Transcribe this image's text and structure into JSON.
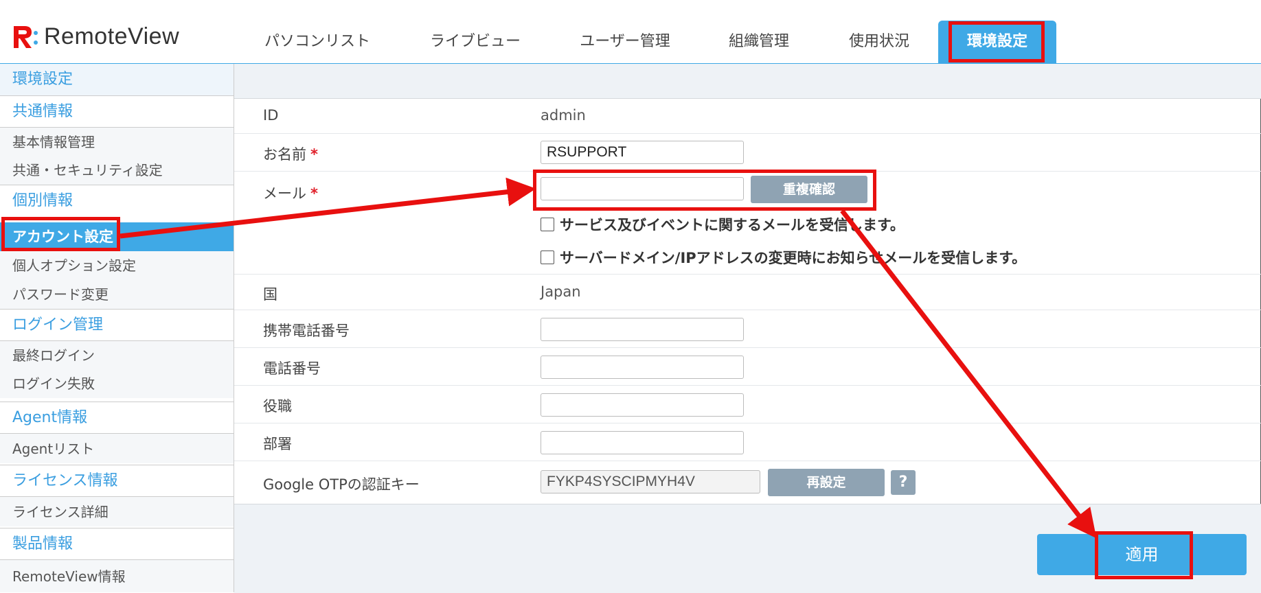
{
  "app": {
    "logo_text": "RemoteView",
    "brand_color": "#3fa9e6",
    "logo_accent_color": "#e8100f"
  },
  "tabs": [
    {
      "label": "パソコンリスト",
      "active": false
    },
    {
      "label": "ライブビュー",
      "active": false
    },
    {
      "label": "ユーザー管理",
      "active": false
    },
    {
      "label": "組織管理",
      "active": false
    },
    {
      "label": "使用状況",
      "active": false
    },
    {
      "label": "環境設定",
      "active": true
    }
  ],
  "sidebar": {
    "title": "環境設定",
    "common_header": "共通情報",
    "basic_info": "基本情報管理",
    "security": "共通・セキュリティ設定",
    "personal_header": "個別情報",
    "account": "アカウント設定",
    "personal_option": "個人オプション設定",
    "password": "パスワード変更",
    "login_header": "ログイン管理",
    "last_login": "最終ログイン",
    "login_fail": "ログイン失敗",
    "agent_header": "Agent情報",
    "agent_list": "Agentリスト",
    "license_header": "ライセンス情報",
    "license_detail": "ライセンス詳細",
    "product_header": "製品情報",
    "remoteview_info": "RemoteView情報"
  },
  "form": {
    "id_label": "ID",
    "id_value": "admin",
    "name_label": "お名前",
    "name_value": "RSUPPORT",
    "required_mark": "*",
    "mail_label": "メール",
    "mail_value": "",
    "duplicate_check": "重複確認",
    "check_service_mail": "サービス及びイベントに関するメールを受信します。",
    "check_server_notice": "サーバードメイン/IPアドレスの変更時にお知らせメールを受信します。",
    "country_label": "国",
    "country_value": "Japan",
    "mobile_label": "携帯電話番号",
    "phone_label": "電話番号",
    "position_label": "役職",
    "department_label": "部署",
    "otp_label": "Google OTPの認証キー",
    "otp_value": "FYKP4SYSCIPMYH4V",
    "reset_button": "再設定",
    "help_button": "?",
    "apply_button": "適用"
  },
  "annotation_color": "#e8100f"
}
